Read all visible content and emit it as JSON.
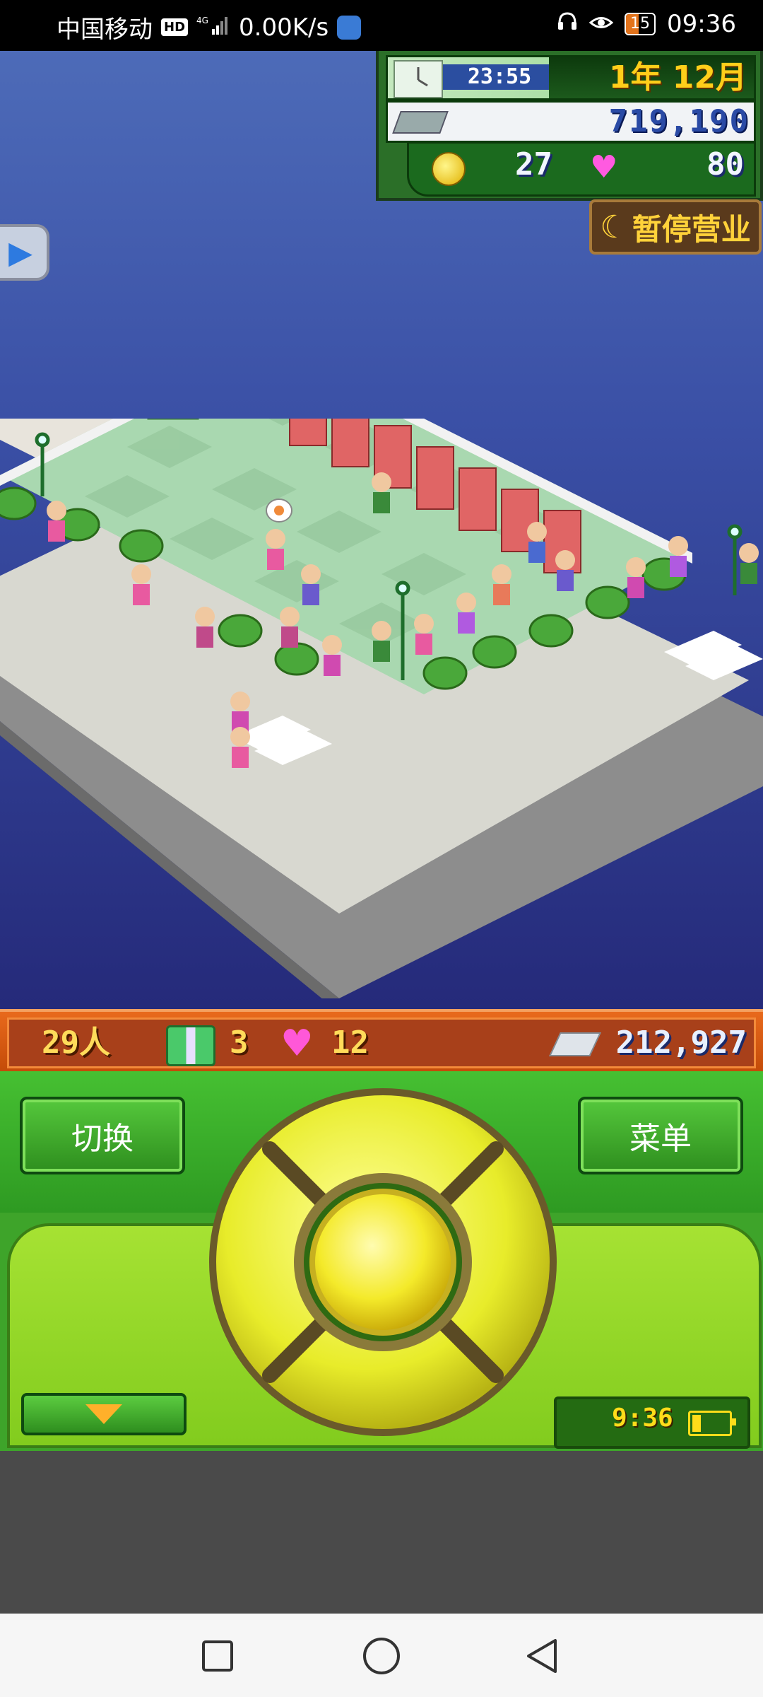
{
  "status_bar": {
    "carrier": "中国移动",
    "hd_badge": "HD",
    "network": "4G",
    "speed": "0.00K/s",
    "battery": "15",
    "time": "09:36"
  },
  "hud": {
    "game_time": "23:55",
    "date": "1年 12月",
    "money": "719,190",
    "coins": "27",
    "hearts": "80",
    "pause_button": "暂停营业"
  },
  "stats": {
    "people": "29人",
    "gifts": "3",
    "hearts": "12",
    "money": "212,927"
  },
  "controller": {
    "switch_button": "切换",
    "menu_button": "菜单",
    "clock": "9:36"
  },
  "colors": {
    "sky_top": "#4d6bb8",
    "sky_bottom": "#252a7a",
    "stats_orange": "#c24a08",
    "controller_green": "#3ea42a",
    "dpad_yellow": "#f4f53a"
  }
}
